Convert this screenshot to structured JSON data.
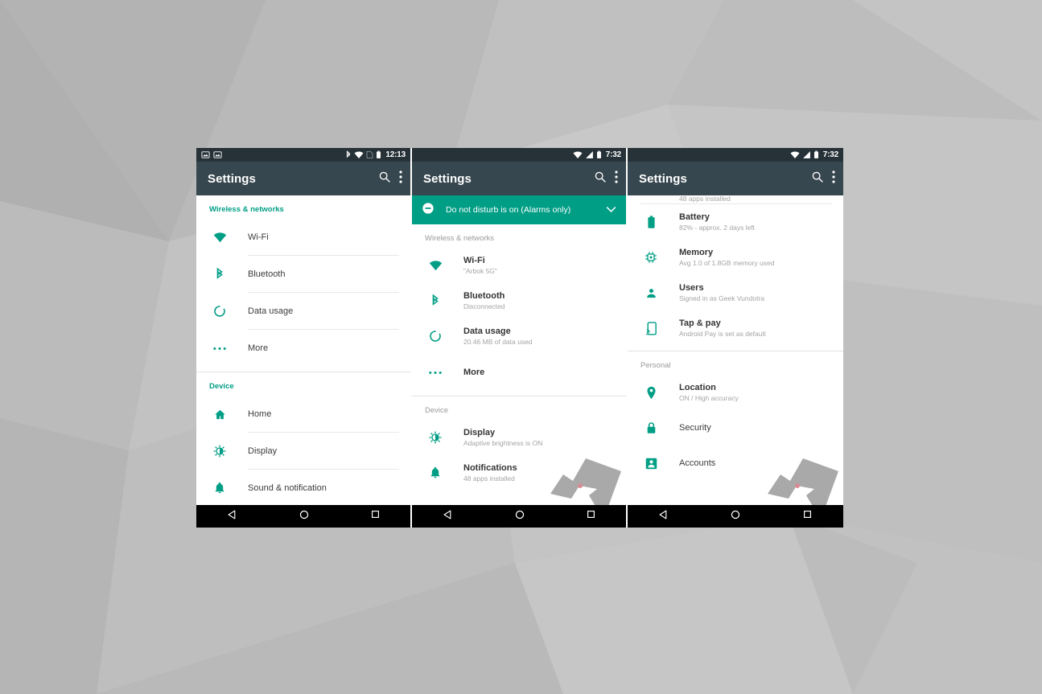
{
  "background": {
    "base_color": "#b6b6b6",
    "style": "low-poly-gray-triangles"
  },
  "theme": {
    "accent": "#009e85",
    "toolbar": "#37474f",
    "statusbar": "#263238",
    "navbar": "#000000",
    "body": "#ffffff",
    "title_text": "#3b3b3b",
    "subtitle_text": "#a4a4a4"
  },
  "phones": [
    {
      "id": "phone-left",
      "statusbar": {
        "clock": "12:13",
        "left_icons": [
          "photo-icon",
          "photo-icon"
        ],
        "right_icons": [
          "bluetooth-icon",
          "wifi-icon",
          "sim-icon",
          "battery-icon"
        ]
      },
      "toolbar": {
        "title": "Settings",
        "actions": [
          "search-icon",
          "overflow-menu-icon"
        ]
      },
      "banner": null,
      "sections": [
        {
          "header": "Wireless & networks",
          "header_style": "teal",
          "rows": [
            {
              "icon": "wifi-icon",
              "title": "Wi-Fi",
              "subtitle": ""
            },
            {
              "icon": "bluetooth-icon",
              "title": "Bluetooth",
              "subtitle": ""
            },
            {
              "icon": "data-usage-icon",
              "title": "Data usage",
              "subtitle": ""
            },
            {
              "icon": "more-icon",
              "title": "More",
              "subtitle": ""
            }
          ]
        },
        {
          "header": "Device",
          "header_style": "teal",
          "rows": [
            {
              "icon": "home-icon",
              "title": "Home",
              "subtitle": ""
            },
            {
              "icon": "display-icon",
              "title": "Display",
              "subtitle": ""
            },
            {
              "icon": "bell-icon",
              "title": "Sound & notification",
              "subtitle": ""
            }
          ]
        }
      ],
      "navbar": [
        "back-icon",
        "home-circle-icon",
        "recents-square-icon"
      ]
    },
    {
      "id": "phone-middle",
      "statusbar": {
        "clock": "7:32",
        "left_icons": [],
        "right_icons": [
          "wifi-icon",
          "signal-icon",
          "battery-icon"
        ]
      },
      "toolbar": {
        "title": "Settings",
        "actions": [
          "search-icon",
          "overflow-menu-icon"
        ]
      },
      "banner": {
        "icon": "do-not-disturb-icon",
        "text": "Do not disturb is on (Alarms only)",
        "chevron": "chevron-down-icon",
        "color": "#009e85"
      },
      "sections": [
        {
          "header": "Wireless & networks",
          "header_style": "plain",
          "rows": [
            {
              "icon": "wifi-icon",
              "title": "Wi-Fi",
              "subtitle": "\"Arbok 5G\""
            },
            {
              "icon": "bluetooth-icon",
              "title": "Bluetooth",
              "subtitle": "Disconnected"
            },
            {
              "icon": "data-usage-icon",
              "title": "Data usage",
              "subtitle": "20.46 MB of data used"
            },
            {
              "icon": "more-icon",
              "title": "More",
              "subtitle": ""
            }
          ]
        },
        {
          "header": "Device",
          "header_style": "plain",
          "rows": [
            {
              "icon": "display-icon",
              "title": "Display",
              "subtitle": "Adaptive brightness is ON"
            },
            {
              "icon": "bell-icon",
              "title": "Notifications",
              "subtitle": "48 apps installed"
            }
          ]
        }
      ],
      "navbar": [
        "back-icon",
        "home-circle-icon",
        "recents-square-icon"
      ]
    },
    {
      "id": "phone-right",
      "statusbar": {
        "clock": "7:32",
        "left_icons": [],
        "right_icons": [
          "wifi-icon",
          "signal-icon",
          "battery-icon"
        ]
      },
      "toolbar": {
        "title": "Settings",
        "actions": [
          "search-icon",
          "overflow-menu-icon"
        ]
      },
      "banner": null,
      "clipped_top_text": "48 apps installed",
      "sections": [
        {
          "header": "",
          "header_style": "plain",
          "rows": [
            {
              "icon": "battery-icon",
              "title": "Battery",
              "subtitle": "82% - approx. 2 days left"
            },
            {
              "icon": "memory-icon",
              "title": "Memory",
              "subtitle": "Avg 1.0 of 1.8GB memory used"
            },
            {
              "icon": "users-icon",
              "title": "Users",
              "subtitle": "Signed in as Geek Vundotra"
            },
            {
              "icon": "tap-pay-icon",
              "title": "Tap & pay",
              "subtitle": "Android Pay is set as default"
            }
          ]
        },
        {
          "header": "Personal",
          "header_style": "plain",
          "rows": [
            {
              "icon": "location-icon",
              "title": "Location",
              "subtitle": "ON / High accuracy"
            },
            {
              "icon": "lock-icon",
              "title": "Security",
              "subtitle": ""
            },
            {
              "icon": "account-icon",
              "title": "Accounts",
              "subtitle": ""
            }
          ]
        }
      ],
      "navbar": [
        "back-icon",
        "home-circle-icon",
        "recents-square-icon"
      ]
    }
  ]
}
